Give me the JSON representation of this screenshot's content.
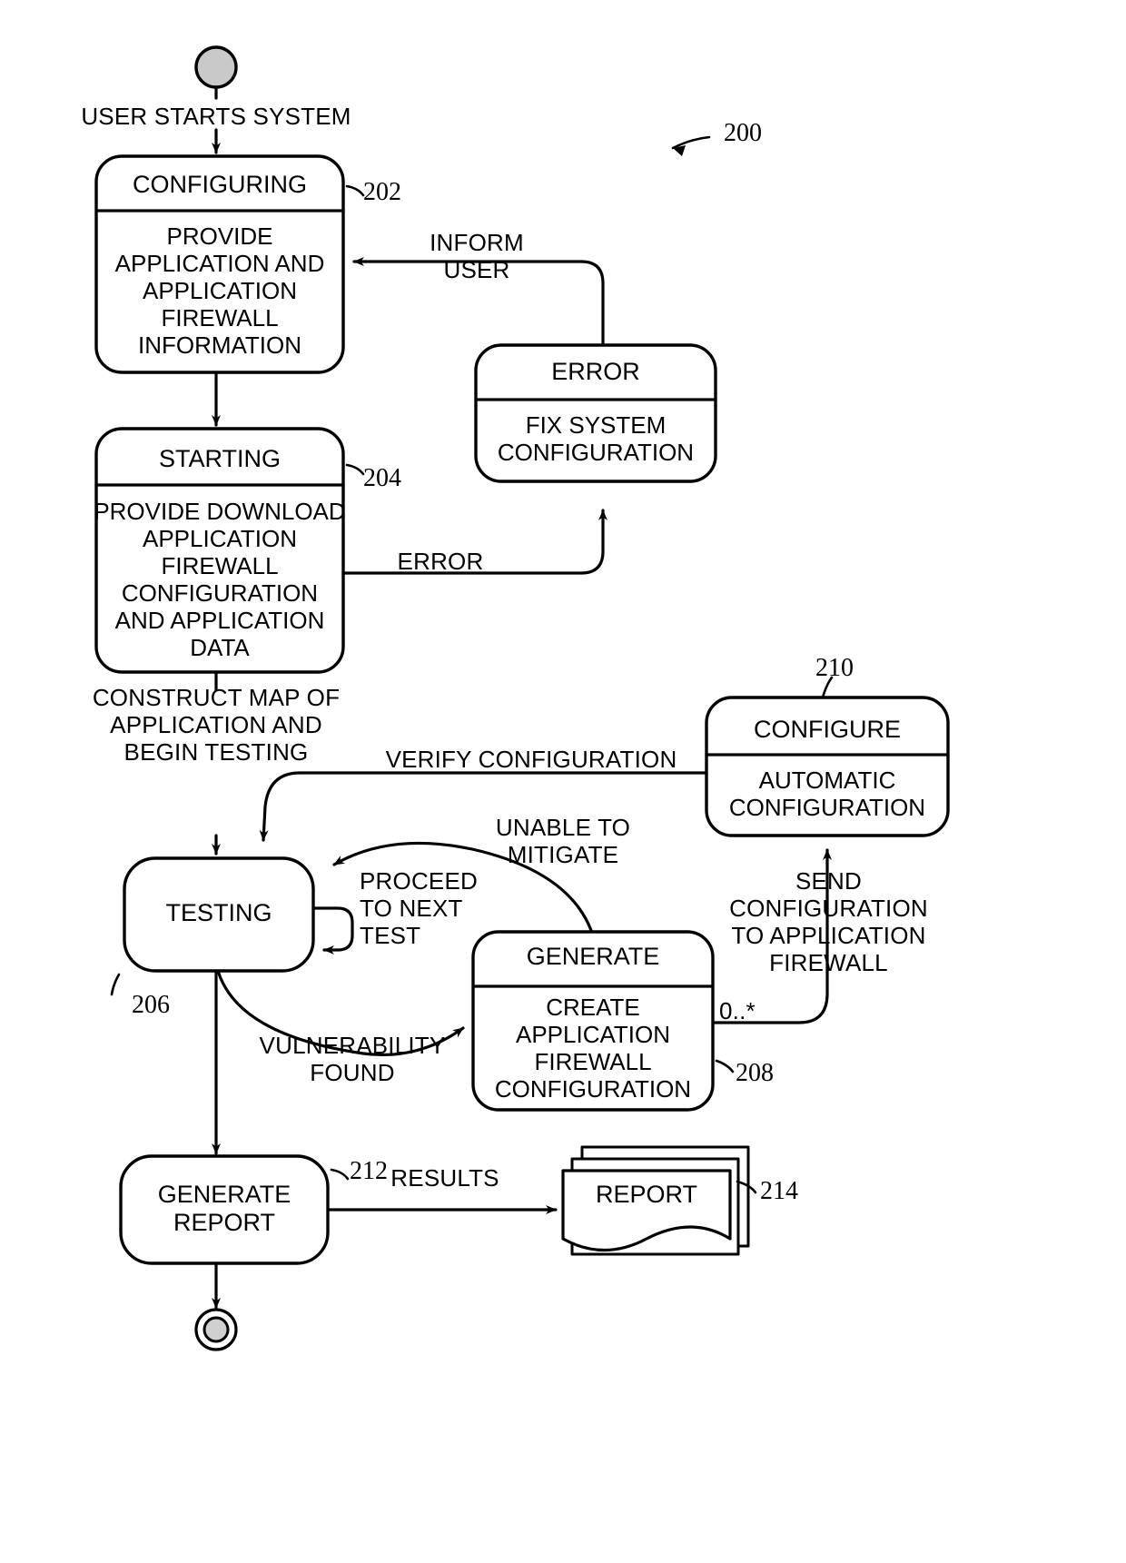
{
  "figure": {
    "reference_label": "200",
    "type": "uml-state-diagram"
  },
  "states": [
    {
      "id": "configuring",
      "title": "CONFIGURING",
      "body": "PROVIDE\nAPPLICATION AND\nAPPLICATION\nFIREWALL\nINFORMATION",
      "ref": "202"
    },
    {
      "id": "starting",
      "title": "STARTING",
      "body": "PROVIDE DOWNLOAD\nAPPLICATION\nFIREWALL\nCONFIGURATION\nAND APPLICATION\nDATA",
      "ref": "204"
    },
    {
      "id": "error",
      "title": "ERROR",
      "body": "FIX SYSTEM\nCONFIGURATION",
      "ref": ""
    },
    {
      "id": "testing",
      "title": "TESTING",
      "body": "",
      "ref": "206"
    },
    {
      "id": "generate",
      "title": "GENERATE",
      "body": "CREATE\nAPPLICATION\nFIREWALL\nCONFIGURATION",
      "ref": "208"
    },
    {
      "id": "configure",
      "title": "CONFIGURE",
      "body": "AUTOMATIC\nCONFIGURATION",
      "ref": "210"
    },
    {
      "id": "generate_report",
      "title": "GENERATE\nREPORT",
      "body": "",
      "ref": "212"
    },
    {
      "id": "report_artifact",
      "title": "REPORT",
      "body": "",
      "ref": "214"
    }
  ],
  "transitions": [
    {
      "id": "start_to_configuring",
      "label": "USER STARTS SYSTEM"
    },
    {
      "id": "error_to_configuring",
      "label": "INFORM\nUSER"
    },
    {
      "id": "starting_to_error",
      "label": "ERROR"
    },
    {
      "id": "starting_to_testing",
      "label": "CONSTRUCT MAP OF\nAPPLICATION AND\nBEGIN TESTING"
    },
    {
      "id": "configure_to_testing",
      "label": "VERIFY CONFIGURATION"
    },
    {
      "id": "testing_self",
      "label": "PROCEED\nTO NEXT\nTEST"
    },
    {
      "id": "generate_to_testing",
      "label": "UNABLE TO\nMITIGATE"
    },
    {
      "id": "testing_to_generate",
      "label": "VULNERABILITY\nFOUND"
    },
    {
      "id": "generate_to_configure",
      "label": "SEND\nCONFIGURATION\nTO APPLICATION\nFIREWALL"
    },
    {
      "id": "generate_multiplicity",
      "label": "0..*"
    },
    {
      "id": "report_results",
      "label": "RESULTS"
    }
  ],
  "markers": {
    "initial_state": "filled-start-circle",
    "final_state": "bullseye-end-circle"
  },
  "colors": {
    "ink": "#000000",
    "paper": "#ffffff",
    "start_fill": "#b8b8b8"
  }
}
